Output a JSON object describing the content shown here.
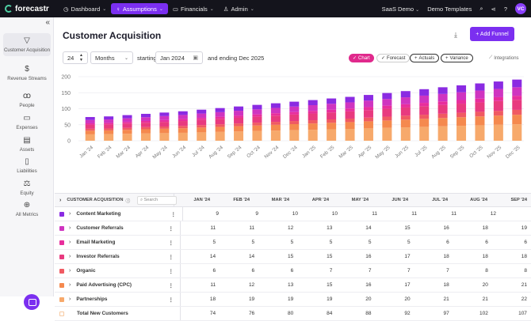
{
  "nav": {
    "logo": "forecastr",
    "items": [
      {
        "label": "Dashboard",
        "icon": "dashboard-icon"
      },
      {
        "label": "Assumptions",
        "icon": "lightbulb-icon"
      },
      {
        "label": "Financials",
        "icon": "book-icon"
      },
      {
        "label": "Admin",
        "icon": "users-icon"
      }
    ],
    "workspace": "SaaS Demo",
    "templates": "Demo Templates",
    "avatar": "VC"
  },
  "sidebar": {
    "items": [
      {
        "label": "Customer Acquisition",
        "icon": "funnel-icon"
      },
      {
        "label": "Revenue Streams",
        "icon": "dollar-icon"
      },
      {
        "label": "People",
        "icon": "people-icon"
      },
      {
        "label": "Expenses",
        "icon": "wallet-icon"
      },
      {
        "label": "Assets",
        "icon": "assets-icon"
      },
      {
        "label": "Liabilities",
        "icon": "document-icon"
      },
      {
        "label": "Equity",
        "icon": "scale-icon"
      },
      {
        "label": "All Metrics",
        "icon": "globe-icon"
      }
    ]
  },
  "page": {
    "title": "Customer Acquisition",
    "add_button": "+ Add Funnel",
    "period_count": "24",
    "period_unit": "Months",
    "starting_label": "starting",
    "start_date": "Jan 2024",
    "ending_label": "and ending Dec 2025"
  },
  "toggles": {
    "chart": "Chart",
    "forecast": "Forecast",
    "actuals": "Actuals",
    "variance": "Variance",
    "integrations": "Integrations"
  },
  "chart_data": {
    "type": "bar",
    "stacked": true,
    "categories": [
      "Jan '24",
      "Feb '24",
      "Mar '24",
      "Apr '24",
      "May '24",
      "Jun '24",
      "Jul '24",
      "Aug '24",
      "Sep '24",
      "Oct '24",
      "Nov '24",
      "Dec '24",
      "Jan '25",
      "Feb '25",
      "Mar '25",
      "Apr '25",
      "May '25",
      "Jun '25",
      "Jul '25",
      "Aug '25",
      "Sep '25",
      "Oct '25",
      "Nov '25",
      "Dec '25"
    ],
    "ylim": [
      0,
      200
    ],
    "yticks": [
      "0",
      "50",
      "100",
      "150",
      "200"
    ],
    "totals": [
      74,
      76,
      80,
      84,
      88,
      92,
      97,
      102,
      107,
      112,
      117,
      122,
      127,
      132,
      137,
      143,
      149,
      155,
      161,
      167,
      173,
      179,
      185,
      191
    ],
    "series": [
      {
        "name": "Partnerships",
        "color": "#f7a96b",
        "share": 0.27
      },
      {
        "name": "Paid Advertising (CPC)",
        "color": "#f5894e",
        "share": 0.155
      },
      {
        "name": "Organic",
        "color": "#f05a62",
        "share": 0.08
      },
      {
        "name": "Investor Referrals",
        "color": "#e83a7f",
        "share": 0.165
      },
      {
        "name": "Email Marketing",
        "color": "#e82e9c",
        "share": 0.065
      },
      {
        "name": "Customer Referrals",
        "color": "#cf34c0",
        "share": 0.14
      },
      {
        "name": "Content Marketing",
        "color": "#8a2be2",
        "share": 0.125
      }
    ]
  },
  "table": {
    "header_label": "CUSTOMER ACQUISITION",
    "search_placeholder": "Search",
    "columns": [
      "JAN '24",
      "FEB '24",
      "MAR '24",
      "APR '24",
      "MAY '24",
      "JUN '24",
      "JUL '24",
      "AUG '24",
      "SEP '24"
    ],
    "rows": [
      {
        "name": "Content Marketing",
        "color": "#8a2be2",
        "values": [
          "9",
          "9",
          "10",
          "10",
          "11",
          "11",
          "11",
          "12"
        ]
      },
      {
        "name": "Customer Referrals",
        "color": "#cf34c0",
        "values": [
          "11",
          "11",
          "12",
          "13",
          "14",
          "15",
          "16",
          "18",
          "19"
        ]
      },
      {
        "name": "Email Marketing",
        "color": "#e82e9c",
        "values": [
          "5",
          "5",
          "5",
          "5",
          "5",
          "5",
          "6",
          "6",
          "6"
        ]
      },
      {
        "name": "Investor Referrals",
        "color": "#e83a7f",
        "values": [
          "14",
          "14",
          "15",
          "15",
          "16",
          "17",
          "18",
          "18",
          "18"
        ]
      },
      {
        "name": "Organic",
        "color": "#f05a62",
        "values": [
          "6",
          "6",
          "6",
          "7",
          "7",
          "7",
          "7",
          "8",
          "8"
        ]
      },
      {
        "name": "Paid Advertising (CPC)",
        "color": "#f5894e",
        "values": [
          "11",
          "12",
          "13",
          "15",
          "16",
          "17",
          "18",
          "20",
          "21"
        ]
      },
      {
        "name": "Partnerships",
        "color": "#f7a96b",
        "values": [
          "18",
          "19",
          "19",
          "19",
          "20",
          "20",
          "21",
          "21",
          "22"
        ]
      }
    ],
    "total_row": {
      "name": "Total New Customers",
      "values": [
        "74",
        "76",
        "80",
        "84",
        "88",
        "92",
        "97",
        "102",
        "107"
      ]
    }
  }
}
